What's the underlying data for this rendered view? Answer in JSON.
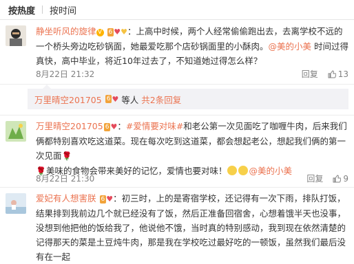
{
  "tabs": [
    "按热度",
    "按时间"
  ],
  "comments": [
    {
      "user": "静坐听风的旋律",
      "level": "6",
      "text_before": "：上高中时候，两个人经常偷偷跑出去，去离学校不远的一个桥头旁边吃砂锅面，她最爱吃那个店砂锅面里的小酥肉。",
      "mention": "@美的小美",
      "text_after": " 时间过得真快，高中毕业，将近10年过去了，不知道她过得怎么样？",
      "time": "8月22日 21:32",
      "reply_label": "回复",
      "likes": "13"
    },
    {
      "user": "万里晴空201705",
      "level": "6",
      "text": "等人",
      "replies": "共2条回复"
    },
    {
      "user": "万里晴空201705",
      "level": "6",
      "hashtag": "#爱情要对味#",
      "text1": "和老公第一次见面吃了咖喱牛肉，后来我们俩都特别喜欢吃这道菜。现在每次吃到这道菜，都会想起老公，想起我们俩的第一次见面",
      "text2": "美味的食物会带来美好的记忆，爱情也要对味！",
      "mention": "@美的小美",
      "time": "8月22日 21:30",
      "reply_label": "回复",
      "likes": "9"
    },
    {
      "user": "爱妃有人想害朕",
      "level": "6",
      "text": "：初三时，上的是寄宿学校，还记得有一次下雨，排队打饭，结果排到我前边几个就已经没有了饭，然后正准备回宿舍，心想着饿半天也没事，没想到他把他的饭给我了，他说他不饿，当时真的特别感动，我到现在依然清楚的记得那天的菜是土豆炖牛肉，那是我在学校吃过最好吃的一顿饭，虽然我们最后没有在一起"
    }
  ]
}
